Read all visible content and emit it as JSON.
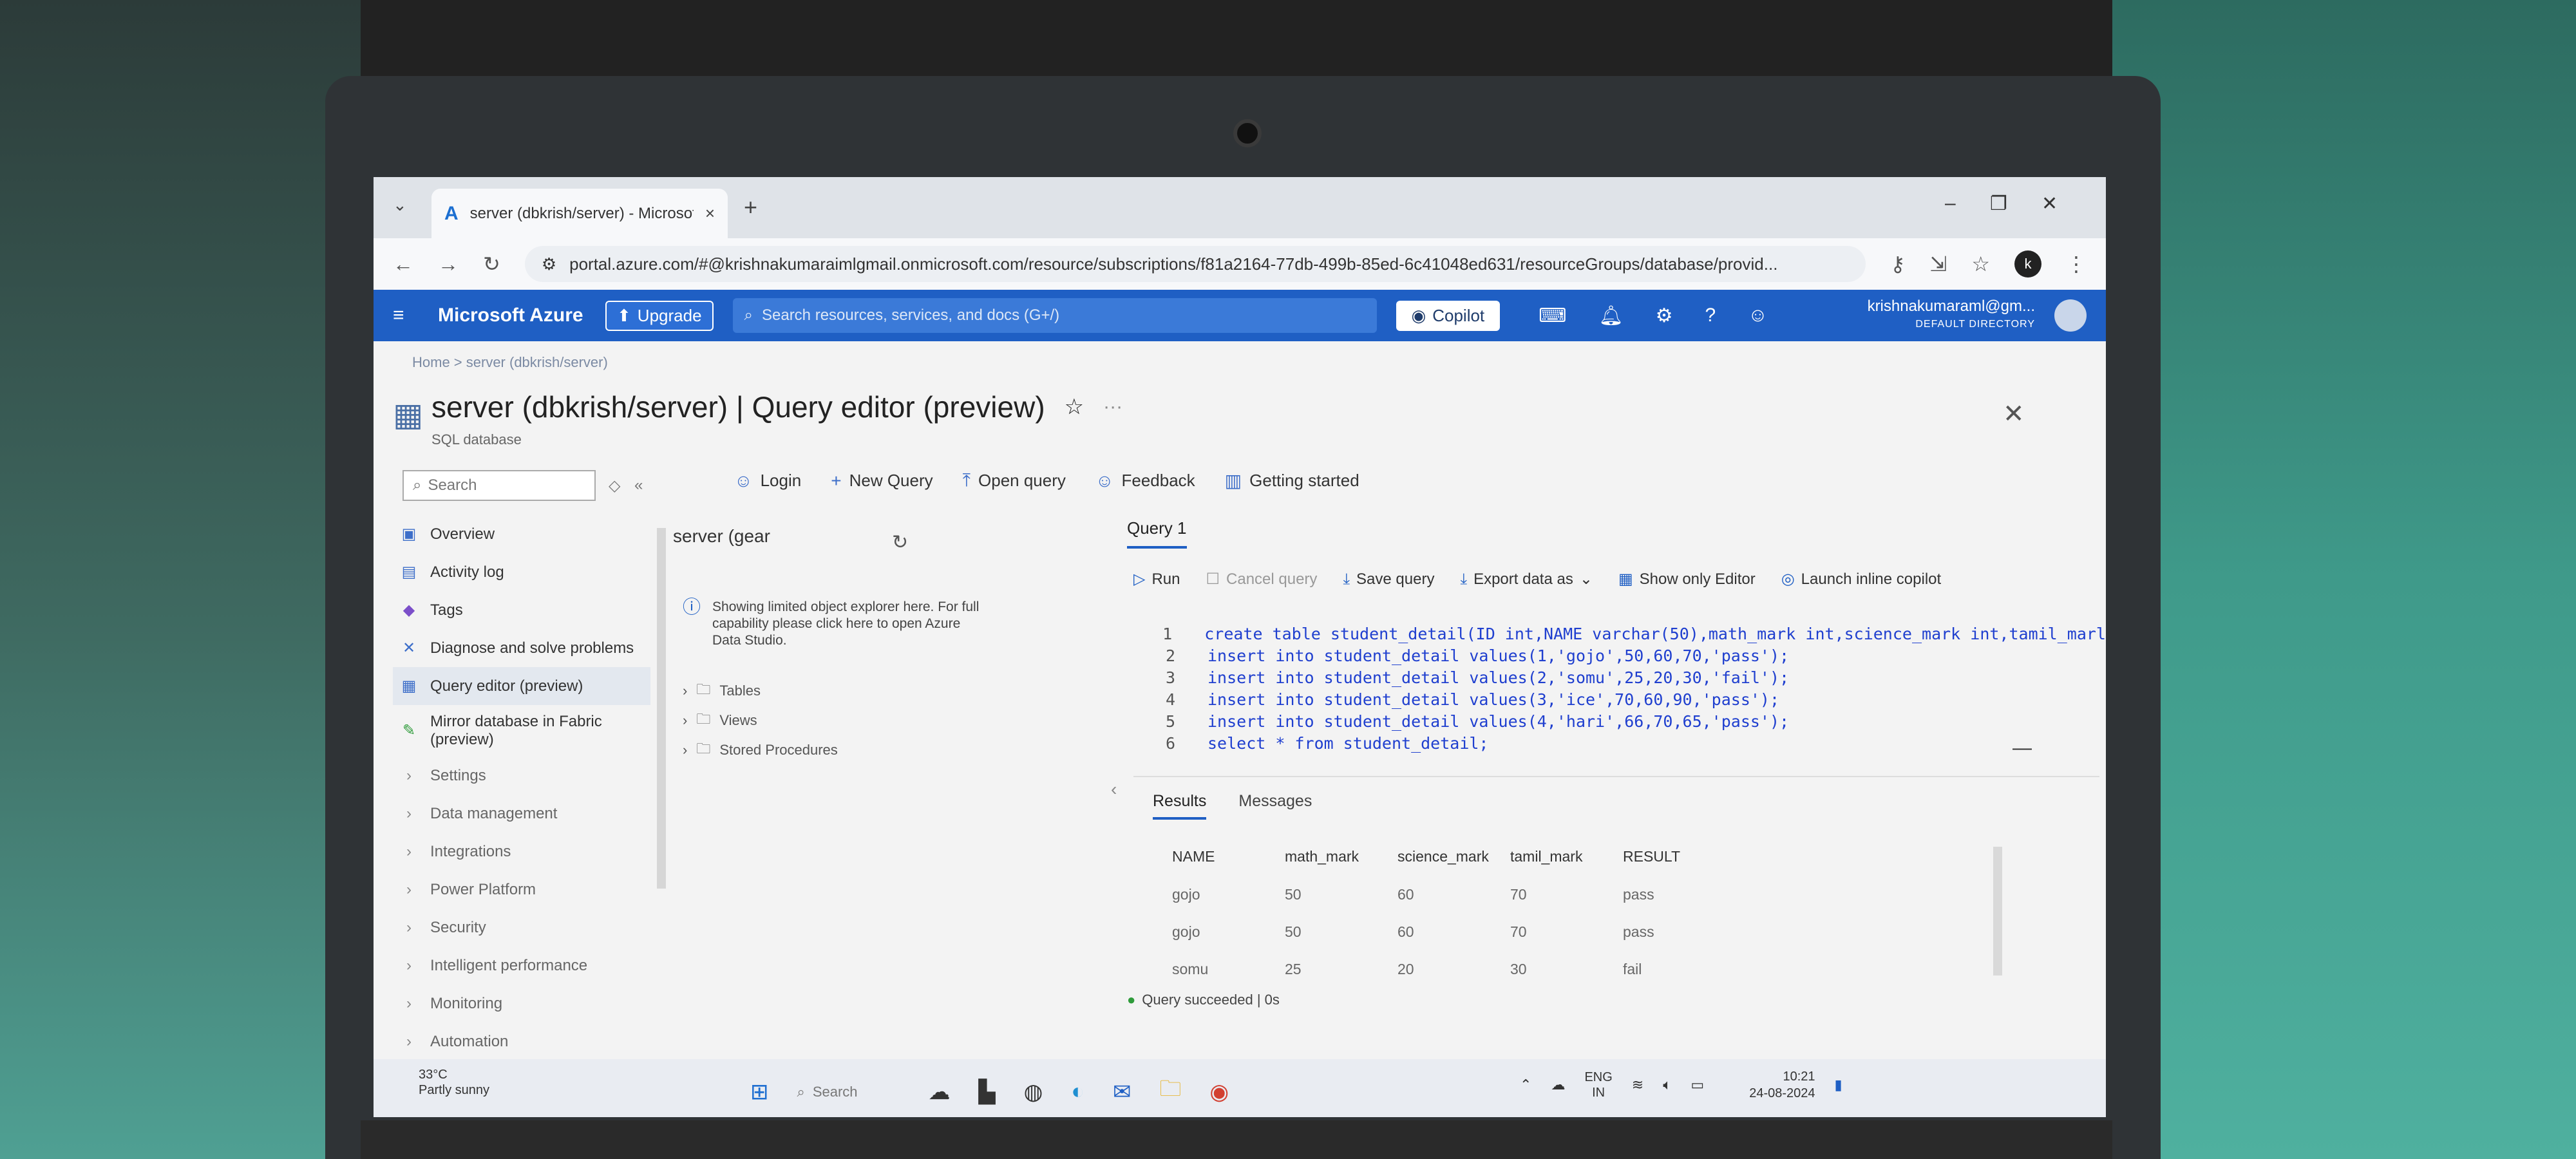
{
  "browser": {
    "tab_title": "server (dbkrish/server) - Microsoft",
    "tab_close": "×",
    "new_tab": "+",
    "url": "portal.azure.com/#@krishnakumaraimlgmail.onmicrosoft.com/resource/subscriptions/f81a2164-77db-499b-85ed-6c41048ed631/resourceGroups/database/provid...",
    "profile_initial": "k"
  },
  "azure": {
    "brand": "Microsoft Azure",
    "upgrade_label": "Upgrade",
    "search_placeholder": "Search resources, services, and docs (G+/)",
    "copilot_label": "Copilot",
    "account_email": "krishnakumaraml@gm...",
    "account_directory": "DEFAULT DIRECTORY"
  },
  "page": {
    "breadcrumb": "Home > server (dbkrish/server)",
    "title": "server (dbkrish/server) | Query editor (preview)",
    "subtitle": "SQL database"
  },
  "sidebar": {
    "search_placeholder": "Search",
    "items": [
      {
        "label": "Overview"
      },
      {
        "label": "Activity log"
      },
      {
        "label": "Tags"
      },
      {
        "label": "Diagnose and solve problems"
      },
      {
        "label": "Query editor (preview)"
      },
      {
        "label": "Mirror database in Fabric (preview)"
      },
      {
        "label": "Settings"
      },
      {
        "label": "Data management"
      },
      {
        "label": "Integrations"
      },
      {
        "label": "Power Platform"
      },
      {
        "label": "Security"
      },
      {
        "label": "Intelligent performance"
      },
      {
        "label": "Monitoring"
      },
      {
        "label": "Automation"
      }
    ]
  },
  "toolbar": {
    "login": "Login",
    "new_query": "New Query",
    "open_query": "Open query",
    "feedback": "Feedback",
    "getting_started": "Getting started"
  },
  "explorer": {
    "title": "server (gear",
    "info": "Showing limited object explorer here. For full capability please click here to open Azure Data Studio.",
    "tree": [
      {
        "label": "Tables"
      },
      {
        "label": "Views"
      },
      {
        "label": "Stored Procedures"
      }
    ]
  },
  "query": {
    "tab_label": "Query 1",
    "run": "Run",
    "cancel": "Cancel query",
    "save": "Save query",
    "export": "Export data as",
    "show_editor": "Show only Editor",
    "copilot": "Launch inline copilot",
    "lines": [
      {
        "n": "1",
        "text": "create table student_detail(ID int,NAME varchar(50),math_mark int,science_mark int,tamil_marl"
      },
      {
        "n": "2",
        "text": "insert into student_detail values(1,'gojo',50,60,70,'pass');"
      },
      {
        "n": "3",
        "text": "insert into student_detail values(2,'somu',25,20,30,'fail');"
      },
      {
        "n": "4",
        "text": "insert into student_detail values(3,'ice',70,60,90,'pass');"
      },
      {
        "n": "5",
        "text": "insert into student_detail values(4,'hari',66,70,65,'pass');"
      },
      {
        "n": "6",
        "text": "select * from student_detail;"
      }
    ]
  },
  "results": {
    "tab_results": "Results",
    "tab_messages": "Messages",
    "columns": [
      "NAME",
      "math_mark",
      "science_mark",
      "tamil_mark",
      "RESULT"
    ],
    "rows": [
      [
        "gojo",
        "50",
        "60",
        "70",
        "pass"
      ],
      [
        "gojo",
        "50",
        "60",
        "70",
        "pass"
      ],
      [
        "somu",
        "25",
        "20",
        "30",
        "fail"
      ]
    ],
    "status": "Query succeeded | 0s"
  },
  "taskbar": {
    "weather_temp": "33°C",
    "weather_desc": "Partly sunny",
    "search_label": "Search",
    "lang": "ENG",
    "lang_region": "IN",
    "time": "10:21",
    "date": "24-08-2024"
  }
}
